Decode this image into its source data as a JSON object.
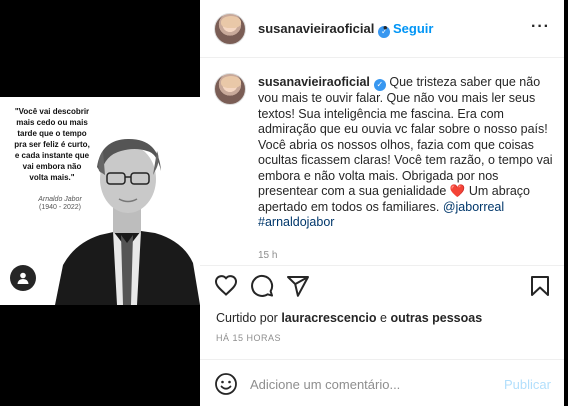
{
  "post": {
    "username": "susanavieiraoficial",
    "verified_glyph": "✓",
    "separator": "•",
    "follow_label": "Seguir",
    "more_label": "···"
  },
  "image": {
    "quote_lines": [
      "\"Você vai descobrir",
      "mais cedo ou mais",
      "tarde que o tempo",
      "pra ser feliz é curto,",
      "e cada instante que",
      "vai embora não",
      "volta mais.\""
    ],
    "author": "Arnaldo Jabor",
    "years": "(1940 - 2022)"
  },
  "caption": {
    "username": "susanavieiraoficial",
    "text": "Que tristeza saber que não vou mais te ouvir falar. Que não vou mais ler seus textos! Sua inteligência me fascina. Era com admiração que eu ouvia vc falar sobre o nosso país! Você abria os nossos olhos, fazia com que coisas ocultas ficassem claras! Você tem razão, o tempo vai embora e não volta mais. Obrigada por nos presentear com a sua genialidade",
    "heart_emoji": "❤️",
    "text_after": "Um abraço apertado em todos os familiares.",
    "mention": "@jaborreal",
    "hashtag": "#arnaldojabor",
    "cut_timestamp": "15 h"
  },
  "likes": {
    "prefix": "Curtido por",
    "user": "lauracrescencio",
    "middle": "e",
    "suffix": "outras pessoas"
  },
  "time_ago": "HÁ 15 HORAS",
  "comment": {
    "placeholder": "Adicione um comentário...",
    "publish_label": "Publicar"
  },
  "colors": {
    "accent": "#0095f6",
    "verified": "#3897f0",
    "heart": "#ed4956",
    "publish_disabled": "#b2dffc"
  },
  "icons": [
    "heart-icon",
    "comment-icon",
    "share-icon",
    "bookmark-icon",
    "emoji-icon",
    "user-tag-icon",
    "more-options-icon"
  ]
}
